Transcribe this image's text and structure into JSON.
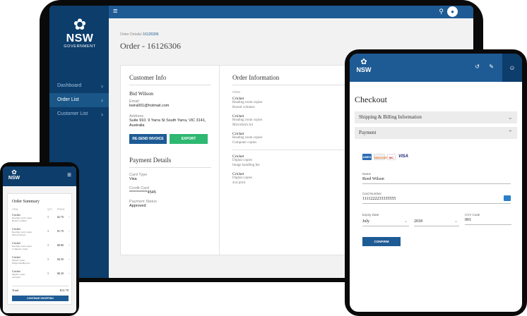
{
  "desktop": {
    "logo": {
      "brand": "NSW",
      "sub": "GOVERNMENT"
    },
    "nav": [
      {
        "label": "Dashboard"
      },
      {
        "label": "Order List"
      },
      {
        "label": "Customer List"
      }
    ],
    "breadcrumb": {
      "parent": "Order Details/",
      "current": "16126306"
    },
    "title": "Order - 16126306",
    "customer": {
      "heading": "Customer Info",
      "name": "Bid Wilson",
      "email_label": "Email",
      "email": "keira001@hotmail.com",
      "address_label": "Address",
      "address": "Suite 910. 9 Yarra St South Yarra, VIC 3141, Australia",
      "resend_label": "RE-SEND INVOICE",
      "export_label": "EXPORT"
    },
    "payment": {
      "heading": "Payment Details",
      "card_type_label": "Card Type",
      "card_type": "Visa",
      "credit_card_label": "Credit Card",
      "credit_card": "************4545",
      "status_label": "Payment Status",
      "status": "Approved"
    },
    "order_info": {
      "heading": "Order Information",
      "col_item": "ITEM",
      "groups": [
        [
          {
            "name": "Cricket",
            "details": [
              "Reading room copies",
              "Bound volumes"
            ]
          },
          {
            "name": "Cricket",
            "details": [
              "Reading room copies",
              "Microform A4"
            ]
          },
          {
            "name": "Cricket",
            "details": [
              "Reading room copies",
              "Computer copies"
            ]
          }
        ],
        [
          {
            "name": "Cricket",
            "details": [
              "Digital copies",
              "Image handling fee"
            ]
          },
          {
            "name": "Cricket",
            "details": [
              "Digital copies",
              "4x4 print"
            ]
          }
        ]
      ]
    }
  },
  "phone": {
    "brand": "NSW",
    "heading": "Order Summary",
    "cols": {
      "item": "ITEM",
      "qty": "QTY",
      "price": "PRICE"
    },
    "items": [
      {
        "name": "Cricket",
        "details": [
          "Reading room copies",
          "Bound volumes"
        ],
        "qty": "1",
        "price": "$2.70",
        "remove": "×"
      },
      {
        "name": "Cricket",
        "details": [
          "Reading room copies",
          "Microform A4"
        ],
        "qty": "1",
        "price": "$1.70",
        "remove": "×"
      },
      {
        "name": "Cricket",
        "details": [
          "Reading room copies",
          "Computer copies"
        ],
        "qty": "1",
        "price": "$0.80",
        "remove": "×"
      },
      {
        "name": "Cricket",
        "details": [
          "Digital copies",
          "Image handling fee"
        ],
        "qty": "1",
        "price": "$4.50",
        "remove": "×"
      },
      {
        "name": "Cricket",
        "details": [
          "Digital copies",
          "4x4 print"
        ],
        "qty": "1",
        "price": "$0.20",
        "remove": "×"
      }
    ],
    "total_label": "Total",
    "total_value": "$12.70",
    "continue_label": "CONTINUE SHOPPING"
  },
  "tablet": {
    "brand": "NSW",
    "title": "Checkout",
    "shipping_label": "Shipping & Billing Information",
    "payment_label": "Payment",
    "card_logos": [
      "AMEX",
      "DISCOVER",
      "MC",
      "VISA"
    ],
    "name_label": "Name",
    "name_value": "Reed Wilson",
    "card_number_label": "Card Number",
    "card_number_value": "1111222233335555",
    "expiry_label": "Expiry Date",
    "month": "July",
    "year": "2018",
    "cvv_label": "CVV Code",
    "cvv": "001",
    "confirm_label": "CONFIRM"
  },
  "colors": {
    "navy": "#0c3d6b",
    "blue": "#1e5b95",
    "green": "#2eb872"
  }
}
